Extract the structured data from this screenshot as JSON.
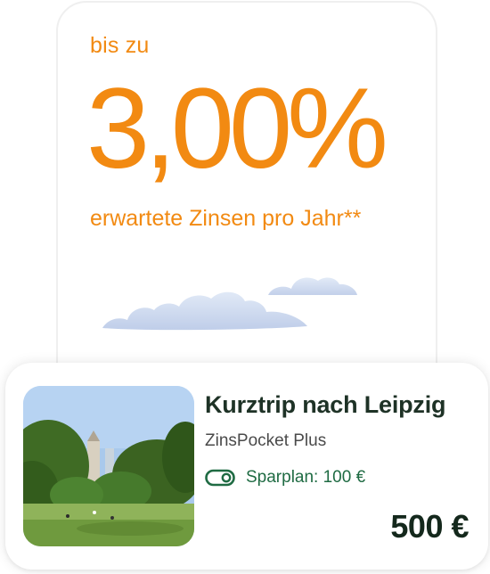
{
  "rate_card": {
    "prefix": "bis zu",
    "rate": "3,00%",
    "subline": "erwartete Zinsen pro Jahr**",
    "accent_color": "#f28a12"
  },
  "pocket_card": {
    "title": "Kurztrip nach Leipzig",
    "subtitle": "ZinsPocket Plus",
    "savings_plan_icon": "toggle-on-icon",
    "savings_plan_label": "Sparplan: 100 €",
    "amount": "500 €",
    "accent_color": "#1f6b43"
  }
}
